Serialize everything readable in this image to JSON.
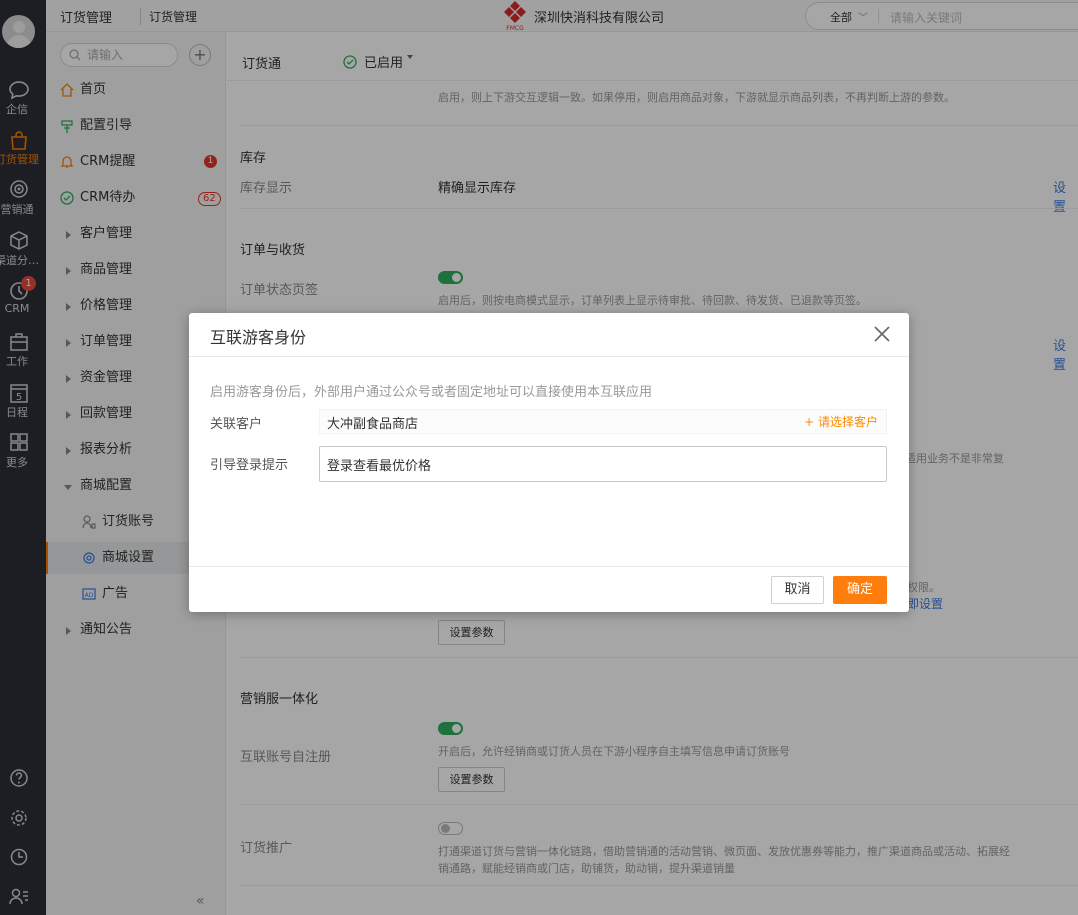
{
  "brand": {
    "company": "深圳快消科技有限公司",
    "logo_text": "FMCG",
    "accent": "#ff8000"
  },
  "rail": {
    "items": [
      {
        "label": "企信"
      },
      {
        "label": "订货管理"
      },
      {
        "label": "营销通"
      },
      {
        "label": "渠道分…"
      },
      {
        "label": "CRM",
        "badge": "1"
      },
      {
        "label": "工作"
      },
      {
        "label": "日程",
        "day": "5"
      },
      {
        "label": "更多"
      }
    ]
  },
  "sidebar": {
    "title": "订货管理",
    "subtitle": "订货管理",
    "search_placeholder": "请输入",
    "add_label": "+",
    "items": [
      {
        "label": "首页"
      },
      {
        "label": "配置引导"
      },
      {
        "label": "CRM提醒",
        "badge": "1"
      },
      {
        "label": "CRM待办",
        "badge": "62"
      },
      {
        "label": "客户管理"
      },
      {
        "label": "商品管理"
      },
      {
        "label": "价格管理"
      },
      {
        "label": "订单管理"
      },
      {
        "label": "资金管理"
      },
      {
        "label": "回款管理"
      },
      {
        "label": "报表分析"
      },
      {
        "label": "商城配置"
      },
      {
        "label": "订货账号"
      },
      {
        "label": "商城设置"
      },
      {
        "label": "广告"
      },
      {
        "label": "通知公告"
      }
    ],
    "collapse_label": "«"
  },
  "topbar": {
    "search_scope": "全部",
    "search_placeholder": "请输入关键词"
  },
  "content": {
    "app_name": "订货通",
    "status": "已启用",
    "top_note": "启用，则上下游交互逻辑一致。如果停用，则启用商品对象，下游就显示商品列表，不再判断上游的参数。",
    "inventory_title": "库存",
    "inventory_label": "库存显示",
    "inventory_value": "精确显示库存",
    "settings_link": "设置",
    "order_title": "订单与收货",
    "order_status_label": "订单状态页签",
    "order_status_desc": "启用后，则按电商模式显示，订单列表上显示待审批、待回款、待发货、已退款等页签。",
    "partial_right1": "适用业务不是非常复",
    "partial_right2": "权限。",
    "partial_right3": "即设置",
    "param_button": "设置参数",
    "marketing_title": "营销服一体化",
    "self_register_label": "互联账号自注册",
    "self_register_desc": "开启后，允许经销商或订货人员在下游小程序自主填写信息申请订货账号",
    "promotion_label": "订货推广",
    "promotion_desc_1": "打通渠道订货与营销一体化链路，借助营销通的活动营销、微页面、发放优惠券等能力，推广渠道商品或活动、拓展经",
    "promotion_desc_2": "销通路，赋能经销商或门店，助铺货，助动销，提升渠道销量"
  },
  "modal": {
    "title": "互联游客身份",
    "tip": "启用游客身份后，外部用户通过公众号或者固定地址可以直接使用本互联应用",
    "customer_label": "关联客户",
    "customer_value": "大冲副食品商店",
    "customer_action": "+ 请选择客户",
    "hint_label": "引导登录提示",
    "hint_value": "登录查看最优价格",
    "cancel": "取消",
    "ok": "确定"
  }
}
